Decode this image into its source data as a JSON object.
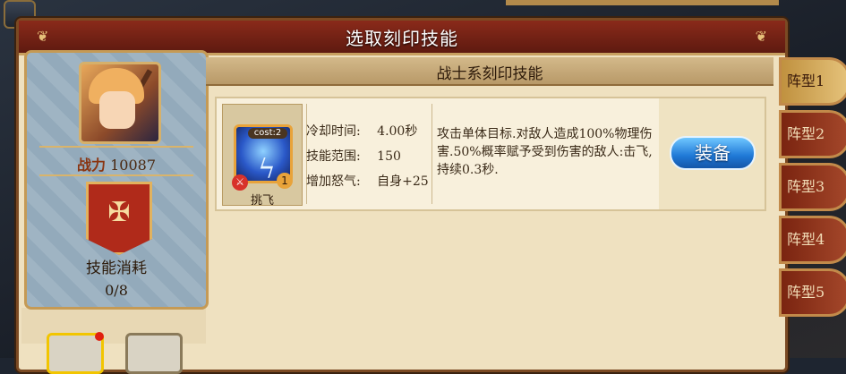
{
  "window": {
    "title": "选取刻印技能"
  },
  "hero": {
    "power_label": "战力",
    "power_value": "10087",
    "cost_label": "技能消耗",
    "cost_value": "0/8"
  },
  "section": {
    "title": "战士系刻印技能"
  },
  "skills": [
    {
      "name": "挑飞",
      "cost_tag": "cost:2",
      "level": "1",
      "stats": [
        {
          "label": "冷却时间:",
          "value": "4.00秒"
        },
        {
          "label": "技能范围:",
          "value": "150"
        },
        {
          "label": "增加怒气:",
          "value": "自身+25"
        }
      ],
      "description": "攻击单体目标.对敌人造成100%物理伤害.50%概率赋予受到伤害的敌人:击飞,持续0.3秒.",
      "equip_label": "装备"
    }
  ],
  "tabs": [
    {
      "label": "阵型1",
      "selected": true
    },
    {
      "label": "阵型2",
      "selected": false
    },
    {
      "label": "阵型3",
      "selected": false
    },
    {
      "label": "阵型4",
      "selected": false
    },
    {
      "label": "阵型5",
      "selected": false
    }
  ],
  "colors": {
    "title_bar": "#8a2a1a",
    "equip_button": "#1f78d6",
    "panel_bg": "#efe1c0"
  }
}
